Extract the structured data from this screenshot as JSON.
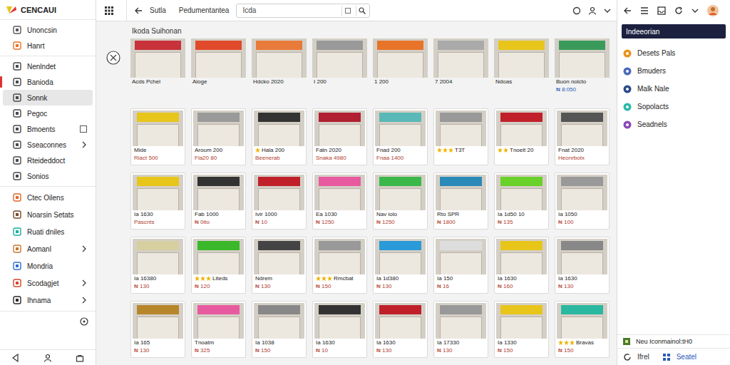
{
  "app": {
    "logo": "CENCAUI"
  },
  "sidebar": {
    "groups": [
      {
        "items": [
          {
            "label": "Unoncsin",
            "color": "#5a5a5a",
            "kind": "plain",
            "selected": false,
            "alert": false
          },
          {
            "label": "Hanrt",
            "color": "#e8742a",
            "kind": "plain",
            "selected": false,
            "alert": false
          }
        ]
      },
      {
        "items": [
          {
            "label": "Nenlndet",
            "color": "#4a4a4a",
            "kind": "plain",
            "selected": false,
            "alert": false
          },
          {
            "label": "Banioda",
            "color": "#4a4a4a",
            "kind": "plain",
            "selected": false,
            "alert": true
          },
          {
            "label": "Sonnk",
            "color": "#4a4a4a",
            "kind": "plain",
            "selected": true,
            "alert": false
          },
          {
            "label": "Pegoc",
            "color": "#4a4a4a",
            "kind": "plain",
            "selected": false,
            "alert": false
          },
          {
            "label": "Bmoents",
            "color": "#4a4a4a",
            "kind": "checkbox",
            "checked": false,
            "selected": false,
            "alert": false
          },
          {
            "label": "Sseaconnes",
            "color": "#4a4a4a",
            "kind": "chevron",
            "selected": false,
            "alert": false
          },
          {
            "label": "Rteideddoct",
            "color": "#4a4a4a",
            "kind": "plain",
            "selected": false,
            "alert": false
          },
          {
            "label": "Sonios",
            "color": "#4a4a4a",
            "kind": "plain",
            "selected": false,
            "alert": false
          }
        ]
      },
      {
        "items": [
          {
            "label": "Ctec Oilens",
            "color": "#e0662a",
            "kind": "plain",
            "selected": false,
            "alert": false
          },
          {
            "label": "Noarsin Setats",
            "color": "#7a4a2a",
            "kind": "plain",
            "selected": false,
            "alert": false
          },
          {
            "label": "Ruati dniles",
            "color": "#17b0a0",
            "kind": "plain",
            "selected": false,
            "alert": false
          },
          {
            "label": "Aomanl",
            "color": "#c9772a",
            "kind": "chevron",
            "selected": false,
            "alert": false
          },
          {
            "label": "Mondria",
            "color": "#2f6fd6",
            "kind": "plain",
            "selected": false,
            "alert": false
          },
          {
            "label": "Scodagjet",
            "color": "#d6452a",
            "kind": "chevron",
            "selected": false,
            "alert": false
          },
          {
            "label": "Ihnama",
            "color": "#2a2a2a",
            "kind": "chevron",
            "selected": false,
            "alert": false
          }
        ]
      }
    ]
  },
  "topbar": {
    "breadcrumb": "Sutla",
    "tab": "Pedumentantea",
    "search": {
      "value": "Icda"
    }
  },
  "main": {
    "title": "Ikoda Suihonan",
    "rows": [
      [
        {
          "kind": "bare",
          "line1": "Acds Pchel",
          "color": "#c8323a"
        },
        {
          "kind": "bare",
          "line1": "Aioge",
          "color": "#e04a2a"
        },
        {
          "kind": "bare",
          "line1": "Hdcko 2020",
          "color": "#e87a3a"
        },
        {
          "kind": "bare",
          "line1": "I 200",
          "color": "#999999"
        },
        {
          "kind": "bare",
          "line1": "1 200",
          "color": "#e8742a"
        },
        {
          "kind": "bare",
          "line1": "7 2004",
          "color": "#aaaaaa"
        },
        {
          "kind": "bare",
          "line1": "Ndoas",
          "color": "#e8c51a"
        },
        {
          "kind": "bare",
          "line1": "Buon nolcto",
          "line2": "₦ 8:050",
          "color": "#3a9a5a"
        }
      ],
      [
        {
          "kind": "card",
          "line1": "Mide",
          "line2": "Riact 500",
          "color": "#e8c51a"
        },
        {
          "kind": "card",
          "line1": "Aroum 200",
          "line2": "Fla20 80",
          "color": "#9a9a9a"
        },
        {
          "kind": "card",
          "line1": "Hala 200",
          "line2": "Beenerab",
          "stars": 1,
          "color": "#333333"
        },
        {
          "kind": "card",
          "line1": "Fatn 2020",
          "line2": "Snaka 4980",
          "color": "#b02030"
        },
        {
          "kind": "card",
          "line1": "Fnad 200",
          "line2": "Fnaa 1400",
          "color": "#5ab8b8"
        },
        {
          "kind": "card",
          "line1": "T3T",
          "stars": 3,
          "color": "#999999"
        },
        {
          "kind": "card",
          "line1": "Tnoelt 20",
          "stars": 2,
          "color": "#c0202a"
        },
        {
          "kind": "card",
          "line1": "Fnat 2020",
          "line2": "Heonrbotx",
          "color": "#555555"
        }
      ],
      [
        {
          "kind": "card",
          "line1": "Ia 1630",
          "line2": "Pascnts",
          "color": "#e8c51a"
        },
        {
          "kind": "card",
          "line1": "Fab 1000",
          "line2": "₦ 0ito",
          "color": "#333333"
        },
        {
          "kind": "card",
          "line1": "Ivir 1000",
          "line2": "₦ 10",
          "color": "#c0202a"
        },
        {
          "kind": "card",
          "line1": "Ea 1030",
          "line2": "₦ 1250",
          "color": "#e85aa0"
        },
        {
          "kind": "card",
          "line1": "Nav iolo",
          "line2": "₦ 1250",
          "color": "#3ab84a"
        },
        {
          "kind": "card",
          "line1": "Rto SPR",
          "line2": "₦ 1800",
          "color": "#2a8ab8"
        },
        {
          "kind": "card",
          "line1": "Ia 1d50 10",
          "line2": "₦ 135",
          "color": "#6ad02a"
        },
        {
          "kind": "card",
          "line1": "Ia 1050",
          "line2": "₦ 100",
          "color": "#999999"
        }
      ],
      [
        {
          "kind": "card",
          "line1": "Ia 16380",
          "line2": "₦ 130",
          "color": "#d8cfa0"
        },
        {
          "kind": "card",
          "line1": "Liteds",
          "line2": "₦ 120",
          "stars": 3,
          "color": "#3ab82a"
        },
        {
          "kind": "card",
          "line1": "Ndrem",
          "line2": "₦ 130",
          "color": "#444444"
        },
        {
          "kind": "card",
          "line1": "Rmcbat",
          "line2": "₦ 150",
          "stars": 3,
          "color": "#999999"
        },
        {
          "kind": "card",
          "line1": "Ia 1d380",
          "line2": "₦ 130",
          "color": "#2a9ad8"
        },
        {
          "kind": "card",
          "line1": "Ia 150",
          "line2": "₦ 16",
          "color": "#dddddd"
        },
        {
          "kind": "card",
          "line1": "Ia 1630",
          "line2": "₦ 160",
          "color": "#e8c51a"
        },
        {
          "kind": "card",
          "line1": "Ia 1630",
          "line2": "₦ 130",
          "color": "#888888"
        }
      ],
      [
        {
          "kind": "card",
          "line1": "Ia 165",
          "line2": "₦ 130",
          "color": "#b8862a"
        },
        {
          "kind": "card",
          "line1": "Tnoatm",
          "line2": "₦ 325",
          "color": "#e85aa0"
        },
        {
          "kind": "card",
          "line1": "Ia 1038",
          "line2": "₦ 150",
          "color": "#888888"
        },
        {
          "kind": "card",
          "line1": "Ia 1630",
          "line2": "₦ 10",
          "color": "#333333"
        },
        {
          "kind": "card",
          "line1": "Ia 1630",
          "line2": "₦ 130",
          "color": "#c0202a"
        },
        {
          "kind": "card",
          "line1": "Ia 17330",
          "line2": "₦ 130",
          "color": "#999999"
        },
        {
          "kind": "card",
          "line1": "Ia 1330",
          "line2": "₦ 150",
          "color": "#e8c51a"
        },
        {
          "kind": "card",
          "line1": "Bravas",
          "line2": "₦ 150",
          "stars": 3,
          "color": "#2ab8a0"
        }
      ]
    ]
  },
  "panel": {
    "items": [
      {
        "label": "Indeeorian",
        "selected": true
      },
      {
        "label": "Desets Pals",
        "color": "#e8921a",
        "selected": false
      },
      {
        "label": "Bmuders",
        "color": "#4a6ab8",
        "selected": false
      },
      {
        "label": "Malk Nale",
        "color": "#2a4a8a",
        "selected": false
      },
      {
        "label": "Sopolacts",
        "color": "#2ab8a8",
        "selected": false
      },
      {
        "label": "Seadnels",
        "color": "#8a4ab8",
        "selected": false
      }
    ],
    "footer": {
      "label": "Neu Iconmainol:tH0"
    },
    "bottom": [
      {
        "label": "Ifrel",
        "color": "#333333"
      },
      {
        "label": "Seatel",
        "color": "#2a5ab8"
      }
    ]
  }
}
